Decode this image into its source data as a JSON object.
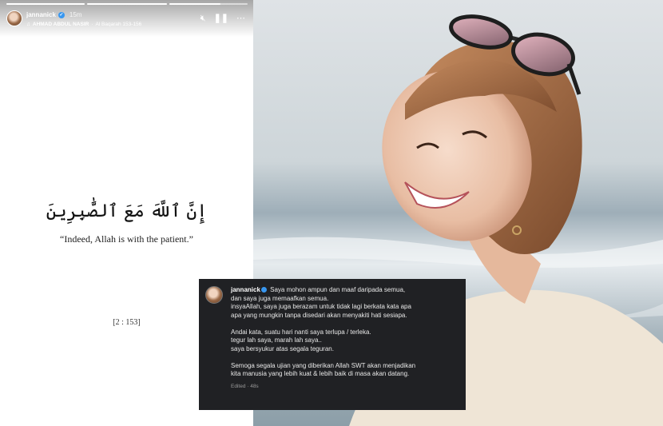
{
  "story": {
    "username": "jannanick",
    "time": "15m",
    "music_artist": "AHMAD ABDUL NASIR",
    "music_separator": " · ",
    "music_track": "Al Baqarah 153-156",
    "progress": [
      1.0,
      1.0,
      0.65
    ],
    "mute_icon": "speaker-muted-icon",
    "pause_icon": "pause-icon",
    "more_icon": "more-icon",
    "arabic_text": "إِنَّ ٱللَّهَ مَعَ ٱلصَّٰبِرِينَ",
    "translation": "“Indeed, Allah is with the patient.”",
    "verse_ref": "[2 : 153]"
  },
  "caption": {
    "username": "jannanick",
    "lines": [
      "Saya mohon ampun dan maaf daripada semua,",
      "dan saya juga memaafkan semua.",
      "insyaAllah, saya juga berazam untuk tidak lagi berkata kata apa",
      "apa yang mungkin tanpa disedari akan menyakiti hati sesiapa.",
      "",
      "Andai kata, suatu hari nanti saya terlupa / terleka.",
      "tegur lah saya, marah lah saya..",
      "saya bersyukur atas segala teguran.",
      "",
      "Semoga segala ujian yang diberikan Allah SWT akan menjadikan",
      "kita manusia yang lebih kuat & lebih baik di masa akan datang."
    ],
    "edited": "Edited · 48s"
  },
  "colors": {
    "caption_bg": "#202124",
    "verified": "#3897f0",
    "sea": "#9fb0ba"
  }
}
